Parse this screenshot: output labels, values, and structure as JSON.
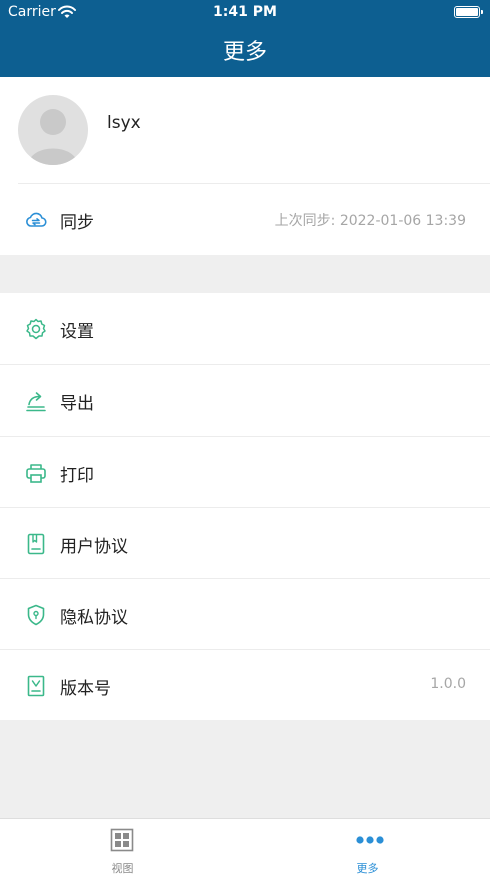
{
  "status_bar": {
    "carrier": "Carrier",
    "time": "1:41 PM"
  },
  "nav": {
    "title": "更多"
  },
  "profile": {
    "username": "lsyx"
  },
  "sync": {
    "label": "同步",
    "last_sync": "上次同步: 2022-01-06 13:39"
  },
  "menu": {
    "settings": "设置",
    "export": "导出",
    "print": "打印",
    "user_agreement": "用户协议",
    "privacy": "隐私协议",
    "version_label": "版本号",
    "version_value": "1.0.0"
  },
  "tabbar": {
    "view": "视图",
    "more": "更多"
  },
  "colors": {
    "header": "#0d5f91",
    "icon_green": "#3bb88a",
    "icon_blue": "#2b8fd6",
    "tab_active": "#2b8fd6"
  }
}
